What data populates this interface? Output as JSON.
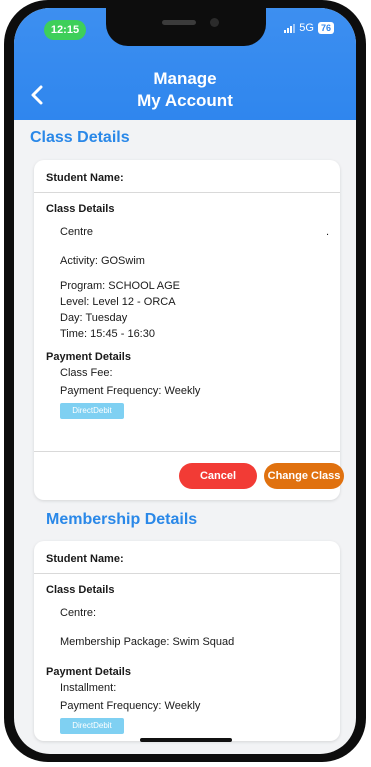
{
  "status_bar": {
    "time": "12:15",
    "network": "5G",
    "battery": "76"
  },
  "header": {
    "title_line1": "Manage",
    "title_line2": "My Account"
  },
  "class_section": {
    "title": "Class Details",
    "student_label": "Student Name:",
    "class_details_heading": "Class Details",
    "centre": "Centre",
    "dot": ".",
    "activity": "Activity: GOSwim",
    "program": "Program: SCHOOL AGE",
    "level": "Level: Level 12 - ORCA",
    "day": "Day: Tuesday",
    "time": "Time: 15:45 - 16:30",
    "payment_heading": "Payment Details",
    "class_fee": "Class Fee:",
    "payment_frequency": "Payment Frequency: Weekly",
    "payment_method": "DirectDebit",
    "cancel_label": "Cancel",
    "change_label": "Change Class"
  },
  "membership_section": {
    "title": "Membership Details",
    "student_label": "Student Name:",
    "class_details_heading": "Class Details",
    "centre": "Centre:",
    "package": "Membership Package: Swim Squad",
    "payment_heading": "Payment Details",
    "installment": "Installment:",
    "payment_frequency": "Payment Frequency: Weekly",
    "payment_method": "DirectDebit"
  },
  "colors": {
    "accent": "#2a88e8",
    "header": "#2f86ee",
    "cancel": "#f23b35",
    "change": "#e0710f",
    "badge": "#7fd0f2"
  }
}
